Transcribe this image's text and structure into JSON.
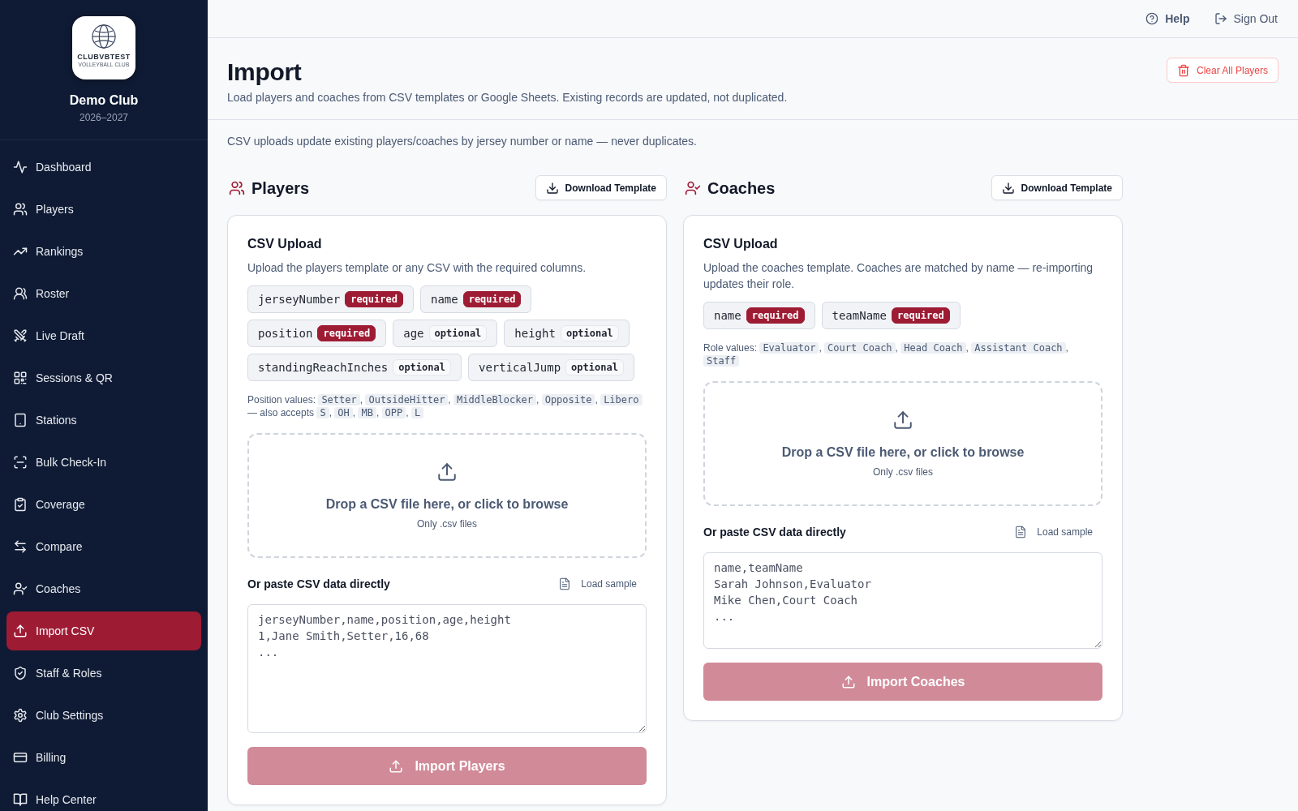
{
  "sidebar": {
    "logo": {
      "name": "CLUBVBTEST",
      "tagline": "VOLLEYBALL CLUB"
    },
    "club_name": "Demo Club",
    "season": "2026–2027",
    "items": [
      {
        "label": "Dashboard",
        "selected": false
      },
      {
        "label": "Players",
        "selected": false
      },
      {
        "label": "Rankings",
        "selected": false
      },
      {
        "label": "Roster",
        "selected": false
      },
      {
        "label": "Live Draft",
        "selected": false
      },
      {
        "label": "Sessions & QR",
        "selected": false
      },
      {
        "label": "Stations",
        "selected": false
      },
      {
        "label": "Bulk Check-In",
        "selected": false
      },
      {
        "label": "Coverage",
        "selected": false
      },
      {
        "label": "Compare",
        "selected": false
      },
      {
        "label": "Coaches",
        "selected": false
      },
      {
        "label": "Import CSV",
        "selected": true
      },
      {
        "label": "Staff & Roles",
        "selected": false
      },
      {
        "label": "Club Settings",
        "selected": false
      },
      {
        "label": "Billing",
        "selected": false
      },
      {
        "label": "Help Center",
        "selected": false
      }
    ]
  },
  "top_bar": {
    "links": [
      {
        "kind": "help",
        "label": "Help"
      },
      {
        "kind": "sign_out",
        "label": "Sign Out"
      }
    ]
  },
  "header": {
    "title": "Import",
    "subtitle": "Load players and coaches from CSV templates or Google Sheets. Existing records are updated, not duplicated.",
    "clear_button": "Clear All Players"
  },
  "notice": "CSV uploads update existing players/coaches by jersey number or name — never duplicates.",
  "sections": [
    {
      "kind": "players",
      "title": "Players",
      "download_button": "Download Template",
      "card": {
        "title": "CSV Upload",
        "description": "Upload the players template or any CSV with the required columns.",
        "columns": [
          {
            "name": "jerseyNumber",
            "badge": "required",
            "required": true
          },
          {
            "name": "name",
            "badge": "required",
            "required": true
          },
          {
            "name": "position",
            "badge": "required",
            "required": true
          },
          {
            "name": "age",
            "badge": "optional",
            "required": false
          },
          {
            "name": "height",
            "badge": "optional",
            "required": false
          },
          {
            "name": "standingReachInches",
            "badge": "optional",
            "required": false
          },
          {
            "name": "verticalJump",
            "badge": "optional",
            "required": false
          }
        ],
        "values": {
          "label": "Position values:",
          "items": [
            "Setter",
            "OutsideHitter",
            "MiddleBlocker",
            "Opposite",
            "Libero"
          ],
          "separator": ",",
          "aliases_label": "— also accepts",
          "aliases": [
            "S",
            "OH",
            "MB",
            "OPP",
            "L"
          ]
        },
        "dropzone": {
          "title": "Drop a CSV file here, or click to browse",
          "hint": "Only .csv files"
        },
        "paste": {
          "label": "Or paste CSV data directly",
          "load_sample": "Load sample",
          "placeholder": "jerseyNumber,name,position,age,height\n1,Jane Smith,Setter,16,68\n..."
        },
        "import_button": {
          "label": "Import Players",
          "disabled": true
        }
      }
    },
    {
      "kind": "coaches",
      "title": "Coaches",
      "download_button": "Download Template",
      "card": {
        "title": "CSV Upload",
        "description": "Upload the coaches template. Coaches are matched by name — re-importing updates their role.",
        "columns": [
          {
            "name": "name",
            "badge": "required",
            "required": true
          },
          {
            "name": "teamName",
            "badge": "required",
            "required": true
          }
        ],
        "values": {
          "label": "Role values:",
          "items": [
            "Evaluator",
            "Court Coach",
            "Head Coach",
            "Assistant Coach",
            "Staff"
          ],
          "separator": ","
        },
        "dropzone": {
          "title": "Drop a CSV file here, or click to browse",
          "hint": "Only .csv files"
        },
        "paste": {
          "label": "Or paste CSV data directly",
          "load_sample": "Load sample",
          "placeholder": "name,teamName\nSarah Johnson,Evaluator\nMike Chen,Court Coach\n..."
        },
        "import_button": {
          "label": "Import Coaches",
          "disabled": true
        }
      }
    }
  ]
}
